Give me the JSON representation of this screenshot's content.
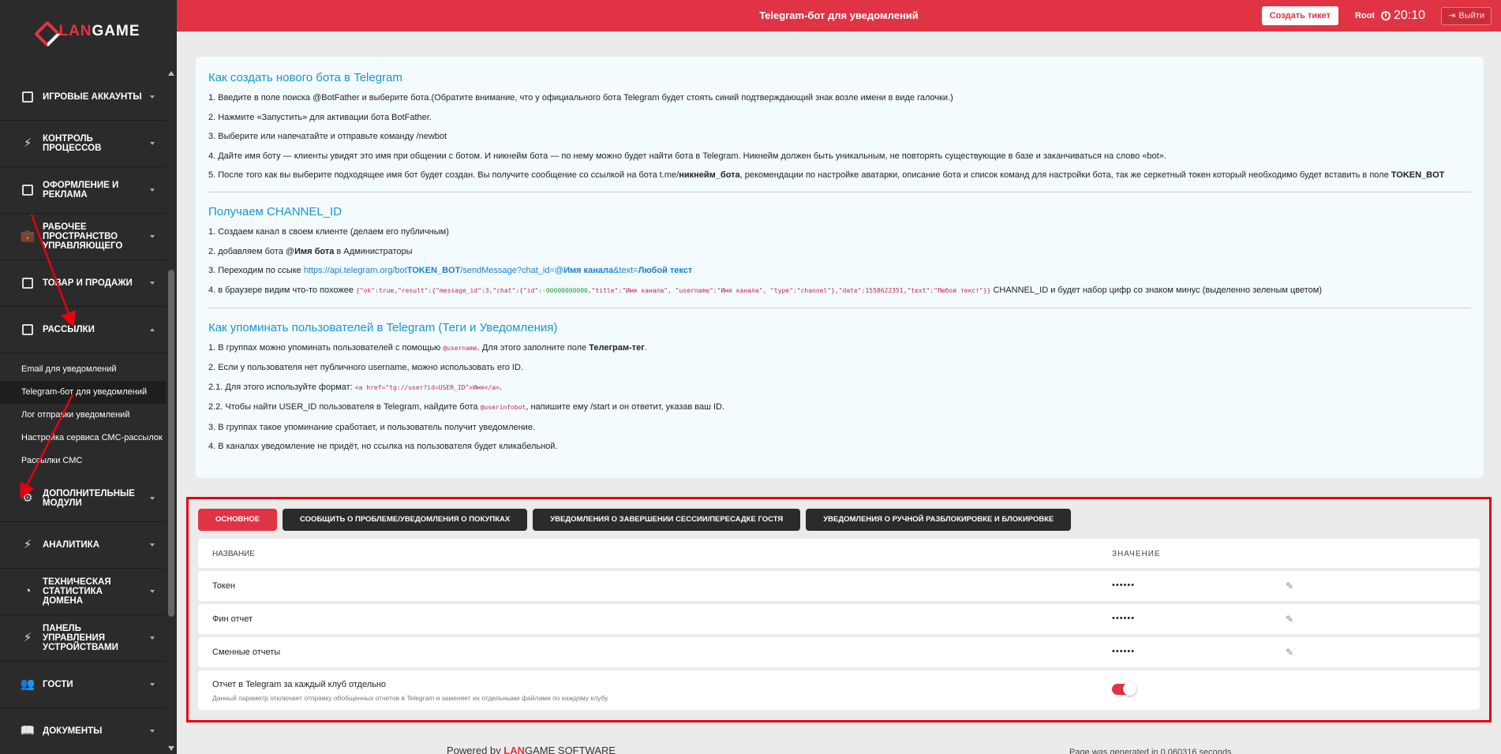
{
  "app": {
    "logo_part1": "LAN",
    "logo_part2": "GAME"
  },
  "topbar": {
    "title": "Telegram-бот для уведомлений",
    "ticket_button": "Создать тикет",
    "user": "Root",
    "time": "20:10",
    "logout": "Выйти"
  },
  "sidebar": {
    "items": [
      {
        "label": "Игровые аккаунты",
        "icon": "id-card-icon"
      },
      {
        "label": "Контроль процессов",
        "icon": "bolt-icon"
      },
      {
        "label": "Оформление и реклама",
        "icon": "edit-box-icon"
      },
      {
        "label": "Рабочее пространство управляющего",
        "icon": "briefcase-icon"
      },
      {
        "label": "Товар и продажи",
        "icon": "sticky-note-icon"
      },
      {
        "label": "Рассылки",
        "icon": "edit-box-icon"
      },
      {
        "label": "Дополнительные модули",
        "icon": "gear-icon"
      },
      {
        "label": "Аналитика",
        "icon": "bolt-icon"
      },
      {
        "label": "Техническая статистика домена",
        "icon": "pie-chart-icon"
      },
      {
        "label": "Панель управления устройствами",
        "icon": "bolt-icon"
      },
      {
        "label": "Гости",
        "icon": "users-icon"
      },
      {
        "label": "Документы",
        "icon": "book-icon"
      }
    ],
    "subitems": [
      "Email для уведомлений",
      "Telegram-бот для уведомлений",
      "Лог отправки уведомлений",
      "Настройка сервиса СМС-рассылок",
      "Рассылки СМС"
    ]
  },
  "info": {
    "s1_title": "Как создать нового бота в Telegram",
    "s1_p1": "1. Введите в поле поиска @BotFather и выберите бота.(Обратите внимание, что у официального бота Telegram будет стоять синий подтверждающий знак возле имени в виде галочки.)",
    "s1_p2": "2. Нажмите «Запустить» для активации бота BotFather.",
    "s1_p3": "3. Выберите или напечатайте и отправьте команду /newbot",
    "s1_p4": "4. Дайте имя боту — клиенты увидят это имя при общении с ботом. И никнейм бота — по нему можно будет найти бота в Telegram. Никнейм должен быть уникальным, не повторять существующие в базе и заканчиваться на слово «bot».",
    "s1_p5a": "5. После того как вы выберите подходящее имя бот будет создан. Вы получите сообщение со ссылкой на бота t.me/",
    "s1_p5b": "никнейм_бота",
    "s1_p5c": ", рекомендации по настройке аватарки, описание бота и список команд для настройки бота, так же серкетный токен который необходимо будет вставить в поле ",
    "s1_p5d": "TOKEN_BOT",
    "s2_title": "Получаем CHANNEL_ID",
    "s2_p1": "1. Создаем канал в своем клиенте (делаем его публичным)",
    "s2_p2a": "2. добавляем бота @",
    "s2_p2b": "Имя бота",
    "s2_p2c": " в Администраторы",
    "s2_p3a": "3. Переходим по ссыке ",
    "s2_p3_link1": "https://api.telegram.org/bot",
    "s2_p3_bold1": "TOKEN_BOT",
    "s2_p3_link2": "/sendMessage?chat_id=@",
    "s2_p3_bold2": "Имя канала",
    "s2_p3_link3": "&text=",
    "s2_p3_bold3": "Любой текст",
    "s2_p4a": "4. в браузере видим что-то похожее ",
    "s2_p4_code1": "{\"ok\":true,\"result\":{\"message_id\":3,\"chat\":{\"id\":",
    "s2_p4_code_green": "-00000000000",
    "s2_p4_code2": ",\"title\":\"Имя канала\", \"username\":\"Имя канала\", \"type\":\"channel\"},\"date\":1558622351,\"text\":\"Любой текст\"}}",
    "s2_p4b": " CHANNEL_ID и будет набор цифр со знаком минус (выделенно зеленым цветом)",
    "s3_title": "Как упоминать пользователей в Telegram (Теги и Уведомления)",
    "s3_p1a": "1. В группах можно упоминать пользователей с помощью ",
    "s3_p1_code": "@username",
    "s3_p1b": ". Для этого заполните поле ",
    "s3_p1_bold": "Телеграм-тег",
    "s3_p1c": ".",
    "s3_p2": "2. Если у пользователя нет публичного username, можно использовать его ID.",
    "s3_p3a": "2.1. Для этого используйте формат: ",
    "s3_p3_code": "<a href=\"tg://user?id=USER_ID\">Имя</a>",
    "s3_p3b": ".",
    "s3_p4a": "2.2. Чтобы найти USER_ID пользователя в Telegram, найдите бота ",
    "s3_p4_code": "@userinfobot",
    "s3_p4b": ", напишите ему /start и он ответит, указав ваш ID.",
    "s3_p5": "3. В группах такое упоминание сработает, и пользователь получит уведомление.",
    "s3_p6": "4. В каналах уведомление не придёт, но ссылка на пользователя будет кликабельной."
  },
  "settings": {
    "tabs": [
      "Основное",
      "Сообщить о проблеме/Уведомления о покупках",
      "Уведомления о завершении сессии/пересадке гостя",
      "Уведомления о ручной разблокировке и блокировке"
    ],
    "header_name": "Название",
    "header_value": "Значение",
    "rows": [
      {
        "name": "Токен",
        "value": "••••••"
      },
      {
        "name": "Фин отчет",
        "value": "••••••"
      },
      {
        "name": "Сменные отчеты",
        "value": "••••••"
      }
    ],
    "toggle_row": {
      "name": "Отчет в Telegram за каждый клуб отдельно",
      "description": "Данный параметр отключает отправку обобщенных отчетов в Telegram и заменяет их отдельными файлами по каждому клубу",
      "enabled": true
    }
  },
  "footer": {
    "powered_prefix": "Powered by ",
    "powered_lan": "LAN",
    "powered_game": "GAME",
    "powered_suffix": " SOFTWARE",
    "generated": "Page was generated in 0.060316 seconds"
  },
  "colors": {
    "accent": "#e03444",
    "sidebar": "#2b2b2b",
    "link": "#1a95cf",
    "annotation": "#e8000f"
  }
}
